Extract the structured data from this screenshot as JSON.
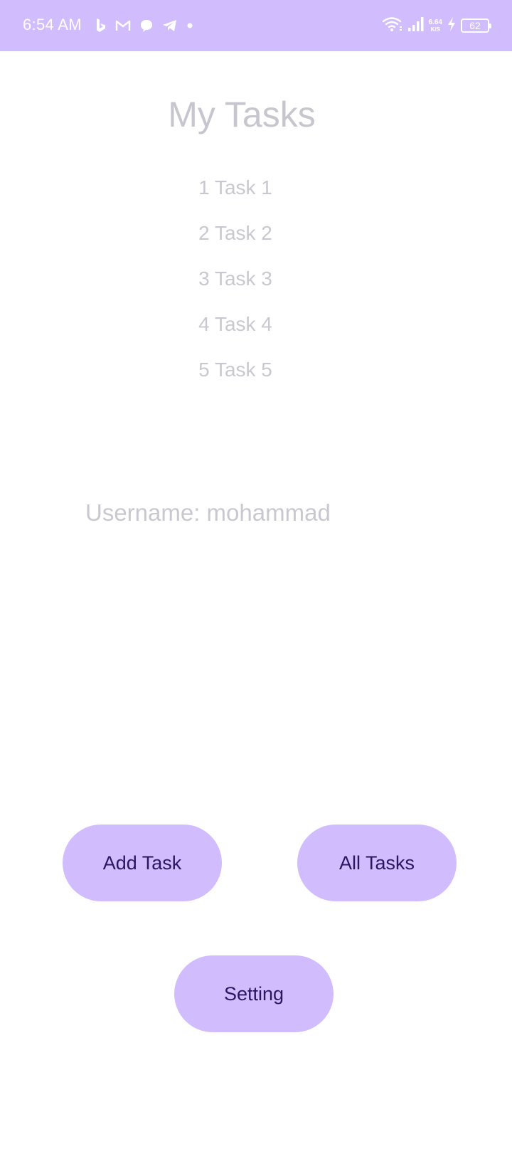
{
  "status_bar": {
    "time": "6:54 AM",
    "notification_icons": [
      "bing-icon",
      "gmail-icon",
      "chat-bubble-icon",
      "telegram-icon",
      "dot-icon"
    ],
    "network_speed_value": "6.64",
    "network_speed_unit": "K/S",
    "battery_level": "62",
    "background_color": "#d1bcfd"
  },
  "main": {
    "title": "My Tasks",
    "tasks": [
      {
        "label": "1 Task 1"
      },
      {
        "label": "2 Task 2"
      },
      {
        "label": "3 Task 3"
      },
      {
        "label": "4 Task 4"
      },
      {
        "label": "5 Task 5"
      }
    ],
    "username_text": "Username: mohammad"
  },
  "buttons": {
    "add_task": "Add Task",
    "all_tasks": "All Tasks",
    "setting": "Setting",
    "background_color": "#d1bcfd",
    "text_color": "#2c1563"
  }
}
